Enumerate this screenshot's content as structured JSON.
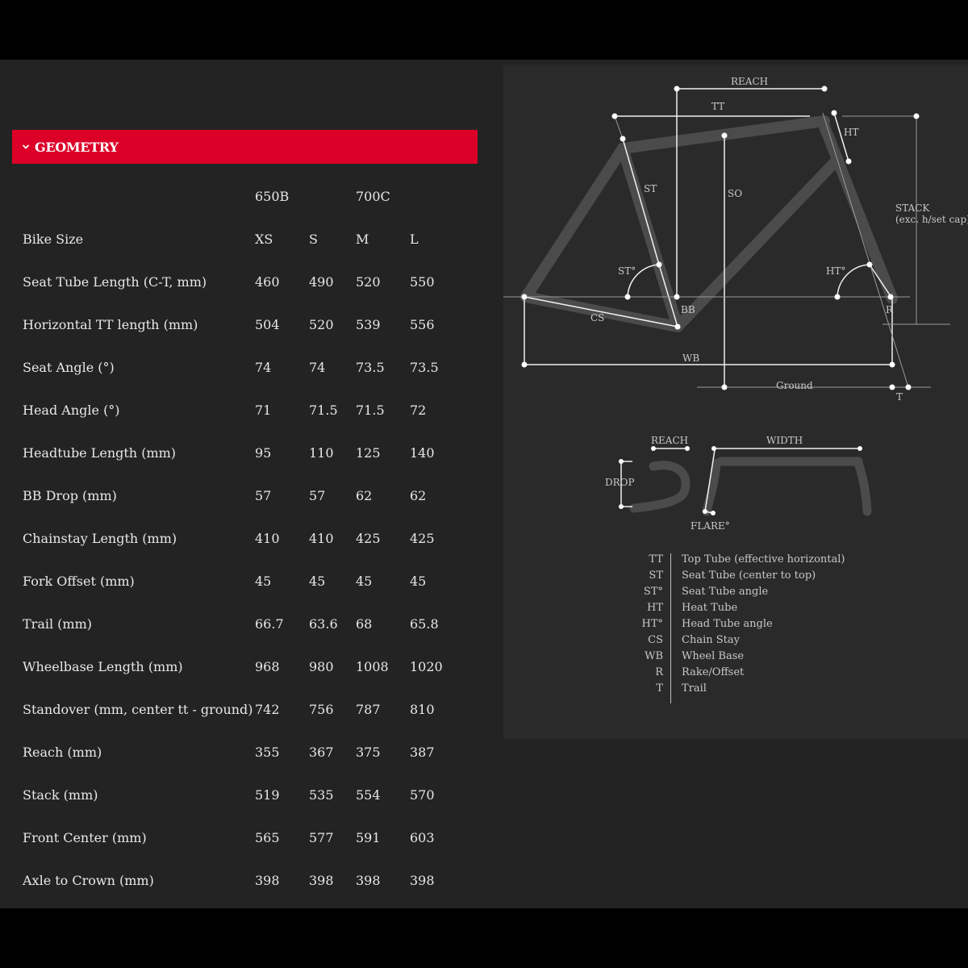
{
  "section": {
    "title": "GEOMETRY"
  },
  "groups": {
    "g1": "650B",
    "g2": "700C"
  },
  "rows": [
    {
      "label": "Bike Size",
      "values": [
        "XS",
        "S",
        "M",
        "L"
      ]
    },
    {
      "label": "Seat Tube Length (C-T, mm)",
      "values": [
        "460",
        "490",
        "520",
        "550"
      ]
    },
    {
      "label": "Horizontal TT length (mm)",
      "values": [
        "504",
        "520",
        "539",
        "556"
      ]
    },
    {
      "label": "Seat Angle (°)",
      "values": [
        "74",
        "74",
        "73.5",
        "73.5"
      ]
    },
    {
      "label": "Head Angle (°)",
      "values": [
        "71",
        "71.5",
        "71.5",
        "72"
      ]
    },
    {
      "label": "Headtube Length (mm)",
      "values": [
        "95",
        "110",
        "125",
        "140"
      ]
    },
    {
      "label": "BB Drop (mm)",
      "values": [
        "57",
        "57",
        "62",
        "62"
      ]
    },
    {
      "label": "Chainstay Length (mm)",
      "values": [
        "410",
        "410",
        "425",
        "425"
      ]
    },
    {
      "label": "Fork Offset (mm)",
      "values": [
        "45",
        "45",
        "45",
        "45"
      ]
    },
    {
      "label": "Trail (mm)",
      "values": [
        "66.7",
        "63.6",
        "68",
        "65.8"
      ]
    },
    {
      "label": "Wheelbase Length (mm)",
      "values": [
        "968",
        "980",
        "1008",
        "1020"
      ]
    },
    {
      "label": "Standover (mm, center tt - ground)",
      "values": [
        "742",
        "756",
        "787",
        "810"
      ]
    },
    {
      "label": "Reach (mm)",
      "values": [
        "355",
        "367",
        "375",
        "387"
      ]
    },
    {
      "label": "Stack (mm)",
      "values": [
        "519",
        "535",
        "554",
        "570"
      ]
    },
    {
      "label": "Front Center (mm)",
      "values": [
        "565",
        "577",
        "591",
        "603"
      ]
    },
    {
      "label": "Axle to Crown (mm)",
      "values": [
        "398",
        "398",
        "398",
        "398"
      ]
    }
  ],
  "diagram": {
    "frame_labels": {
      "reach": "REACH",
      "tt": "TT",
      "ht": "HT",
      "st": "ST",
      "so": "SO",
      "stack": "STACK",
      "stack_note": "(exc. h/set cap)",
      "st_angle": "ST°",
      "ht_angle": "HT°",
      "bb": "BB",
      "r": "R",
      "cs": "CS",
      "wb": "WB",
      "ground": "Ground",
      "t": "T"
    },
    "bar_labels": {
      "reach": "REACH",
      "width": "WIDTH",
      "drop": "DROP",
      "flare": "FLARE°"
    }
  },
  "legend": [
    {
      "abbr": "TT",
      "desc": "Top Tube (effective horizontal)"
    },
    {
      "abbr": "ST",
      "desc": "Seat Tube (center to top)"
    },
    {
      "abbr": "ST°",
      "desc": "Seat Tube angle"
    },
    {
      "abbr": "HT",
      "desc": "Heat Tube"
    },
    {
      "abbr": "HT°",
      "desc": "Head Tube angle"
    },
    {
      "abbr": "CS",
      "desc": "Chain Stay"
    },
    {
      "abbr": "WB",
      "desc": "Wheel Base"
    },
    {
      "abbr": "R",
      "desc": "Rake/Offset"
    },
    {
      "abbr": "T",
      "desc": "Trail"
    }
  ],
  "colors": {
    "accent": "#dc0028",
    "background": "#232323",
    "panel": "#2a2a2a"
  }
}
